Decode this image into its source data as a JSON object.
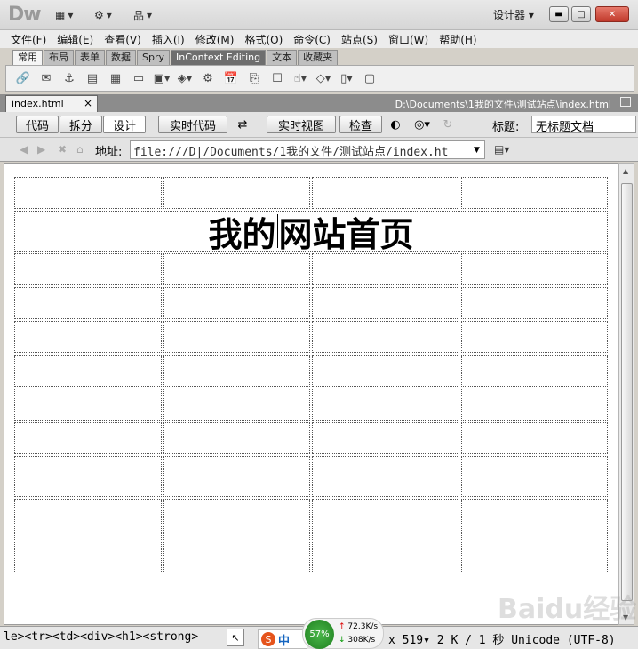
{
  "app": {
    "logo": "Dw",
    "workspace_label": "设计器",
    "window_buttons": {
      "minimize": "▬",
      "maximize": "□",
      "close": "✕"
    }
  },
  "menu": [
    "文件(F)",
    "编辑(E)",
    "查看(V)",
    "插入(I)",
    "修改(M)",
    "格式(O)",
    "命令(C)",
    "站点(S)",
    "窗口(W)",
    "帮助(H)"
  ],
  "insert_tabs": [
    "常用",
    "布局",
    "表单",
    "数据",
    "Spry",
    "InContext Editing",
    "文本",
    "收藏夹"
  ],
  "insert_icons": [
    "hyperlink-icon",
    "email-link-icon",
    "named-anchor-icon",
    "horizontal-rule-icon",
    "table-icon",
    "div-icon",
    "image-icon",
    "media-icon",
    "date-icon",
    "server-include-icon",
    "comment-icon",
    "head-icon",
    "script-icon",
    "templates-icon",
    "tag-chooser-icon"
  ],
  "document": {
    "tab_name": "index.html",
    "tab_close": "×",
    "path": "D:\\Documents\\1我的文件\\测试站点\\index.html"
  },
  "doc_toolbar": {
    "code": "代码",
    "split": "拆分",
    "design": "设计",
    "live_code": "实时代码",
    "live_view": "实时视图",
    "inspect": "检查",
    "title_label": "标题:",
    "title_value": "无标题文档"
  },
  "address": {
    "label": "地址:",
    "value": "file:///D|/Documents/1我的文件/测试站点/index.ht"
  },
  "page": {
    "heading": "我的网站首页",
    "table_columns": 4,
    "rows_before_heading": 1,
    "rows_after_heading": 8
  },
  "status": {
    "tag_selector": "le><tr><td><div><h1><strong>",
    "info": "x 519▾ 2 K / 1 秒 Unicode (UTF-8)",
    "ime_label": "中",
    "ime_logo": "S",
    "net_percent": "57%",
    "net_up": "72.3K/s",
    "net_down": "308K/s"
  },
  "watermark": "Baidu经验"
}
